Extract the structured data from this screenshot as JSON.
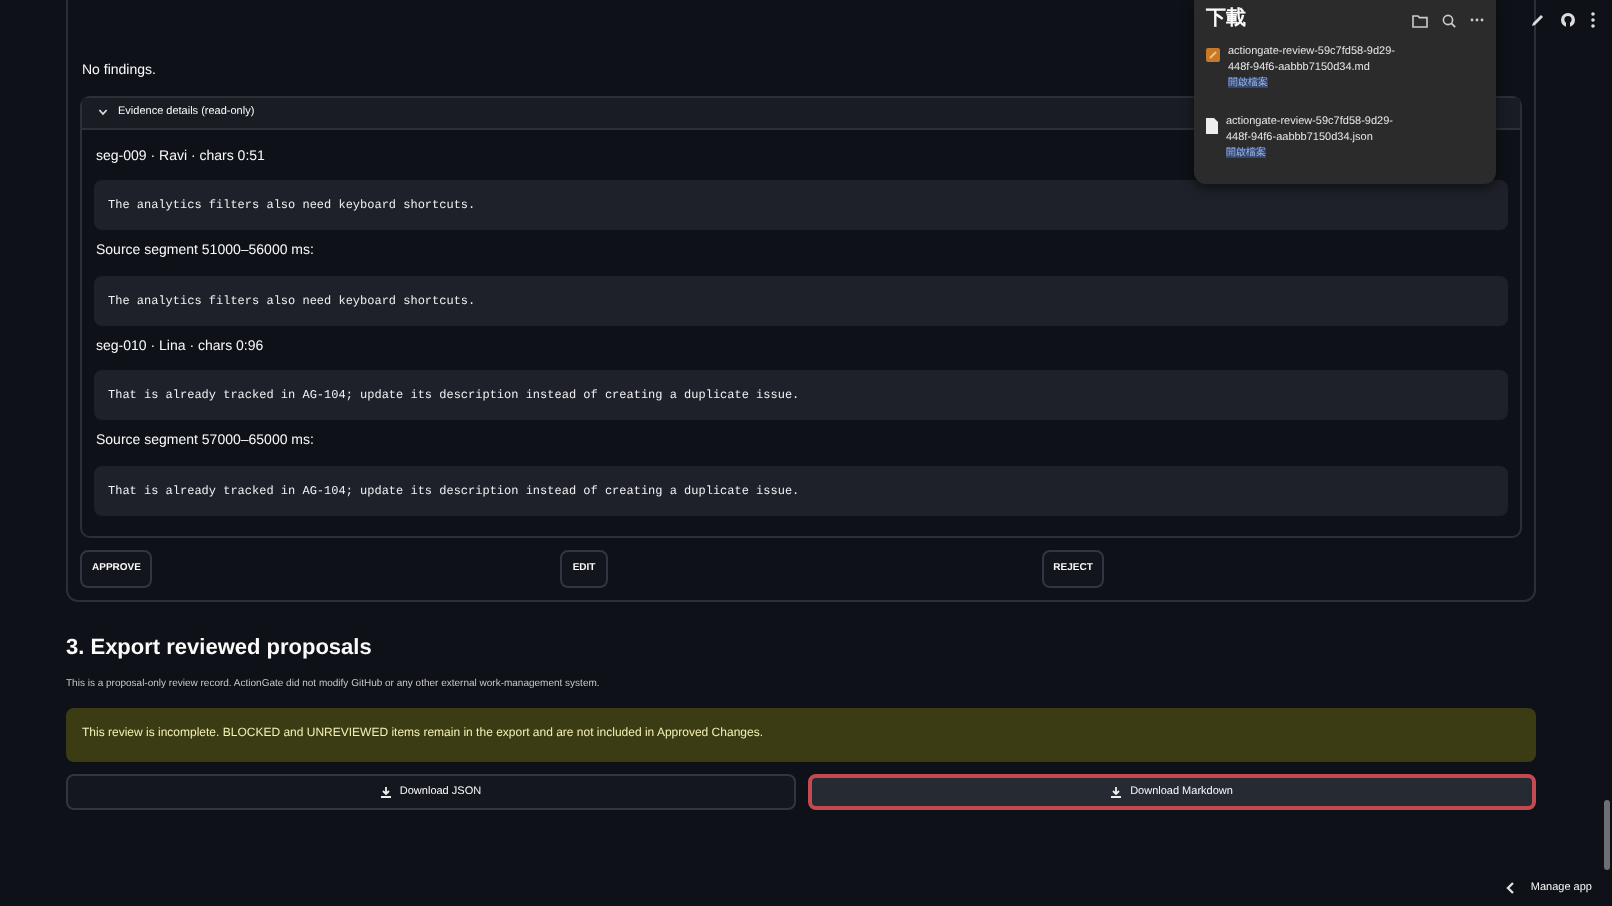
{
  "downloads_panel": {
    "title": "下載",
    "items": [
      {
        "kind": "md",
        "filename": "actiongate-review-59c7fd58-9d29-448f-94f6-aabbb7150d34.md",
        "action": "開啟檔案"
      },
      {
        "kind": "json",
        "filename": "actiongate-review-59c7fd58-9d29-448f-94f6-aabbb7150d34.json",
        "action": "開啟檔案"
      }
    ]
  },
  "review_card": {
    "findings_text": "No findings.",
    "evidence": {
      "label": "Evidence details (read-only)",
      "expanded": true,
      "blocks": [
        {
          "kind": "heading",
          "text": "seg-009 · Ravi · chars 0:51"
        },
        {
          "kind": "code",
          "text": "The analytics filters also need keyboard shortcuts."
        },
        {
          "kind": "heading",
          "text": "Source segment 51000–56000 ms:"
        },
        {
          "kind": "code",
          "text": "The analytics filters also need keyboard shortcuts."
        },
        {
          "kind": "heading",
          "text": "seg-010 · Lina · chars 0:96"
        },
        {
          "kind": "code",
          "text": "That is already tracked in AG-104; update its description instead of creating a duplicate issue."
        },
        {
          "kind": "heading",
          "text": "Source segment 57000–65000 ms:"
        },
        {
          "kind": "code",
          "text": "That is already tracked in AG-104; update its description instead of creating a duplicate issue."
        }
      ]
    },
    "actions": [
      "APPROVE",
      "EDIT",
      "REJECT"
    ]
  },
  "export": {
    "heading": "3. Export reviewed proposals",
    "caption": "This is a proposal-only review record. ActionGate did not modify GitHub or any other external work-management system.",
    "warning": "This review is incomplete. BLOCKED and UNREVIEWED items remain in the export and are not included in Approved Changes.",
    "buttons": [
      {
        "label": "Download JSON",
        "focused": false
      },
      {
        "label": "Download Markdown",
        "focused": true
      }
    ]
  },
  "footer": {
    "manage_app": "Manage app"
  }
}
